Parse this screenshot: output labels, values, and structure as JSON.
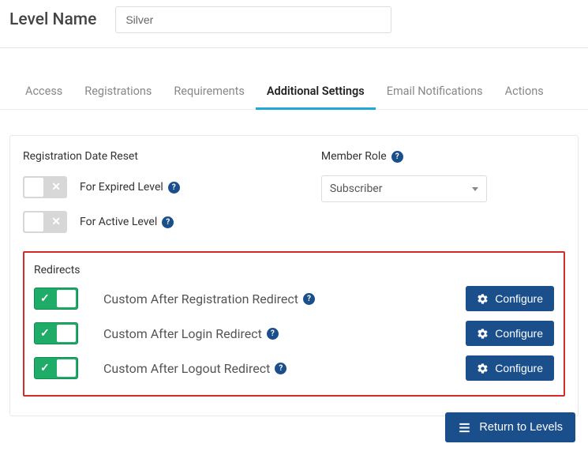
{
  "header": {
    "label": "Level Name",
    "value": "Silver"
  },
  "tabs": {
    "access": "Access",
    "registrations": "Registrations",
    "requirements": "Requirements",
    "additional": "Additional Settings",
    "email": "Email Notifications",
    "actions": "Actions"
  },
  "regReset": {
    "title": "Registration Date Reset",
    "expired": "For Expired Level",
    "active": "For Active Level"
  },
  "memberRole": {
    "title": "Member Role",
    "selected": "Subscriber"
  },
  "redirects": {
    "title": "Redirects",
    "reg": "Custom After Registration Redirect",
    "login": "Custom After Login Redirect",
    "logout": "Custom After Logout Redirect",
    "configure": "Configure"
  },
  "footer": {
    "return": "Return to Levels"
  }
}
